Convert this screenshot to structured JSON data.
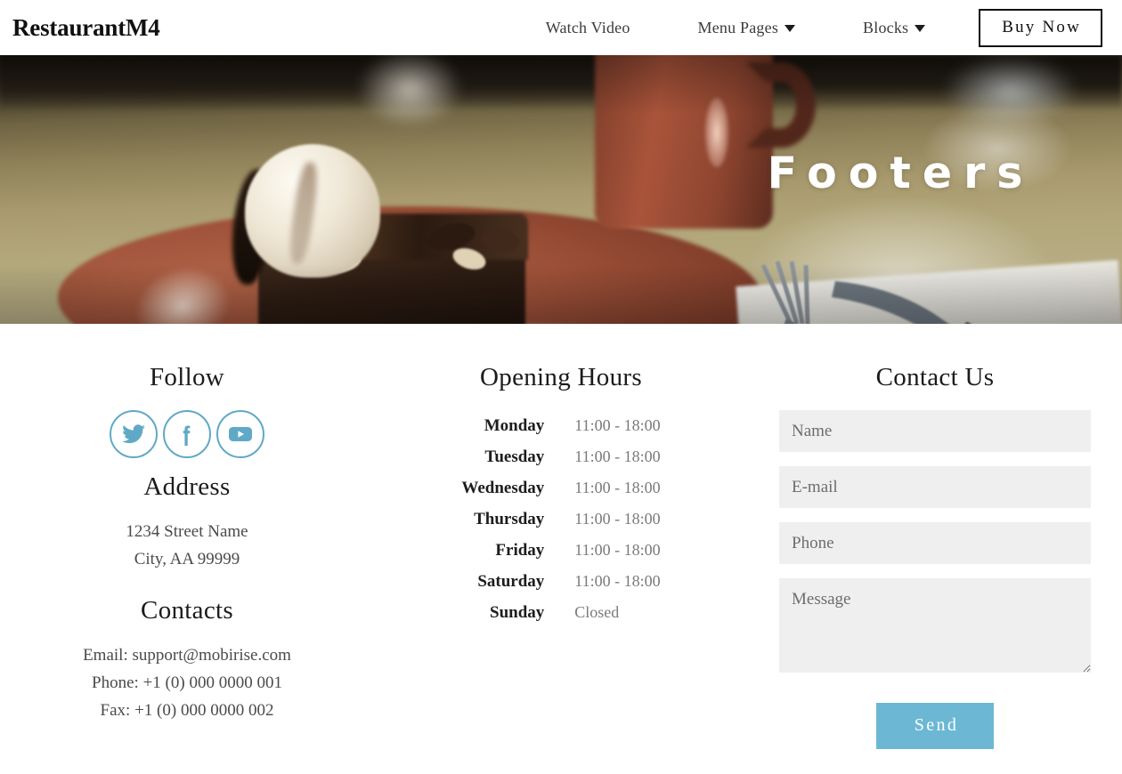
{
  "navbar": {
    "brand": "RestaurantM4",
    "links": [
      {
        "label": "Watch Video",
        "has_dropdown": false
      },
      {
        "label": "Menu Pages",
        "has_dropdown": true
      },
      {
        "label": "Blocks",
        "has_dropdown": true
      }
    ],
    "cta": "Buy Now"
  },
  "hero": {
    "title": "Footers",
    "image_alt": "Chocolate brownie with vanilla ice cream on a terracotta plate, mug and cutlery on a wooden table"
  },
  "footer": {
    "follow": {
      "title": "Follow",
      "socials": [
        {
          "name": "twitter-icon",
          "label": "Twitter"
        },
        {
          "name": "facebook-icon",
          "label": "Facebook"
        },
        {
          "name": "youtube-icon",
          "label": "YouTube"
        }
      ]
    },
    "address": {
      "title": "Address",
      "line1": "1234 Street Name",
      "line2": "City, AA 99999"
    },
    "contacts": {
      "title": "Contacts",
      "email": "Email: support@mobirise.com",
      "phone": "Phone: +1 (0) 000 0000 001",
      "fax": "Fax: +1 (0) 000 0000 002"
    },
    "hours": {
      "title": "Opening Hours",
      "rows": [
        {
          "day": "Monday",
          "time": "11:00 - 18:00"
        },
        {
          "day": "Tuesday",
          "time": "11:00 - 18:00"
        },
        {
          "day": "Wednesday",
          "time": "11:00 - 18:00"
        },
        {
          "day": "Thursday",
          "time": "11:00 - 18:00"
        },
        {
          "day": "Friday",
          "time": "11:00 - 18:00"
        },
        {
          "day": "Saturday",
          "time": "11:00 - 18:00"
        },
        {
          "day": "Sunday",
          "time": "Closed"
        }
      ]
    },
    "contact_form": {
      "title": "Contact Us",
      "name_placeholder": "Name",
      "name_value": "",
      "email_placeholder": "E-mail",
      "email_value": "",
      "phone_placeholder": "Phone",
      "phone_value": "",
      "message_placeholder": "Message",
      "message_value": "",
      "submit_label": "Send"
    }
  },
  "colors": {
    "accent": "#6cb8d4",
    "social_outline": "#5fa9c6",
    "field_bg": "#efefef",
    "text": "#1b1b1b",
    "muted": "#7a7a7a"
  }
}
